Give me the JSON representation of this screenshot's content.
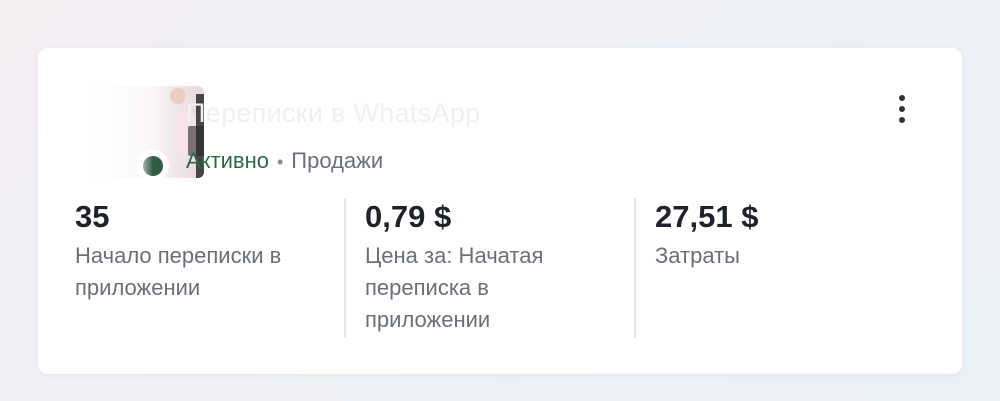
{
  "ad": {
    "title": "Переписки в WhatsApp",
    "status": "Активно",
    "separator": "•",
    "objective": "Продажи"
  },
  "metrics": [
    {
      "value": "35",
      "label": "Начало переписки в приложении"
    },
    {
      "value": "0,79 $",
      "label": "Цена за: Начатая переписка в приложении"
    },
    {
      "value": "27,51 $",
      "label": "Затраты"
    }
  ],
  "icons": {
    "menu": "more-vertical-icon",
    "status": "status-dot-icon"
  },
  "colors": {
    "status_active": "#2d6a4b",
    "value_text": "#1f2229",
    "label_text": "#6b6f78",
    "card_background": "#ffffff"
  }
}
